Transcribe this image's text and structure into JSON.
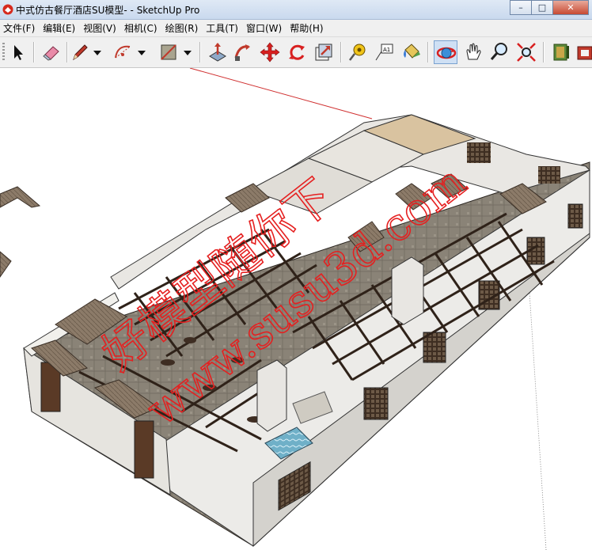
{
  "window": {
    "title": "中式仿古餐厅酒店SU模型- - SketchUp Pro",
    "minimize_glyph": "–",
    "maximize_glyph": "□",
    "close_glyph": "✕"
  },
  "menu": {
    "items": [
      "文件(F)",
      "编辑(E)",
      "视图(V)",
      "相机(C)",
      "绘图(R)",
      "工具(T)",
      "窗口(W)",
      "帮助(H)"
    ]
  },
  "toolbar": {
    "tools": [
      "select-icon",
      "eraser-icon",
      "pencil-icon",
      "line-dropdown-icon",
      "arc-icon",
      "arc-dropdown-icon",
      "rectangle-icon",
      "rectangle-dropdown-icon",
      "push-pull-icon",
      "follow-me-icon",
      "move-icon",
      "rotate-icon",
      "offset-icon",
      "tape-measure-icon",
      "text-icon",
      "paint-bucket-icon",
      "orbit-icon",
      "pan-icon",
      "zoom-icon",
      "zoom-extents-icon",
      "components-icon",
      "materials-icon"
    ],
    "active_tool": "orbit-icon"
  },
  "watermark": {
    "line1": "好模型随你下",
    "line2": "www.susu3d.com",
    "color": "#e52020"
  },
  "colors": {
    "wall": "#ecebe8",
    "floor": "#8c8578",
    "timber": "#4a3528",
    "roof": "#8a7a6a"
  }
}
